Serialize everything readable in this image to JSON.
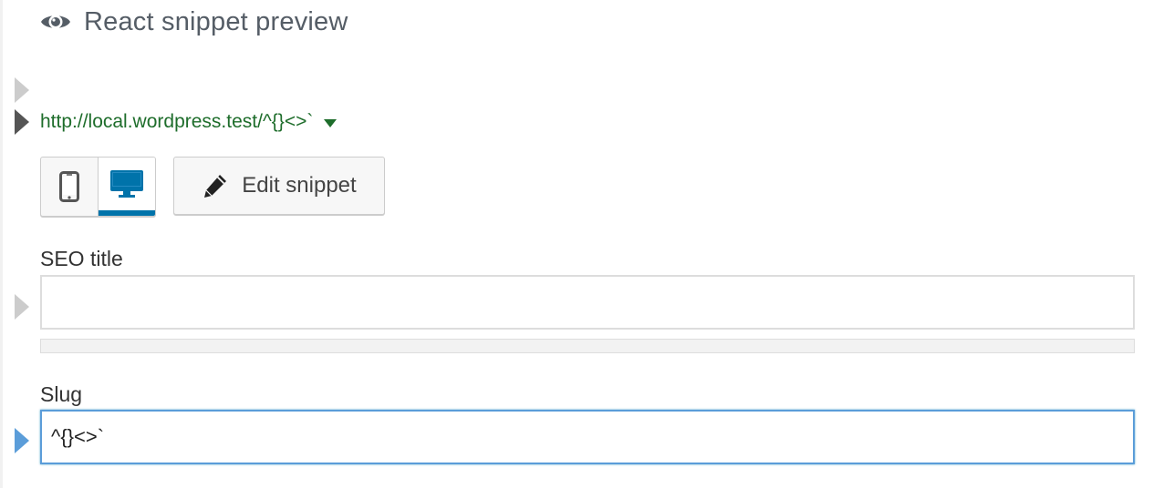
{
  "header": {
    "icon": "eye-icon",
    "title": "React snippet preview"
  },
  "preview": {
    "url": "http://local.wordpress.test/^{}<>`",
    "url_color": "#1e6d2b"
  },
  "mode_switch": {
    "mobile_icon": "mobile-phone-icon",
    "desktop_icon": "desktop-monitor-icon",
    "active": "desktop",
    "accent": "#0073aa"
  },
  "edit_button": {
    "icon": "pencil-icon",
    "label": "Edit snippet"
  },
  "seo_title": {
    "label": "SEO title",
    "value": "",
    "progress": 0
  },
  "slug": {
    "label": "Slug",
    "value": "^{}<>`",
    "focus_color": "#5b9dd9"
  }
}
